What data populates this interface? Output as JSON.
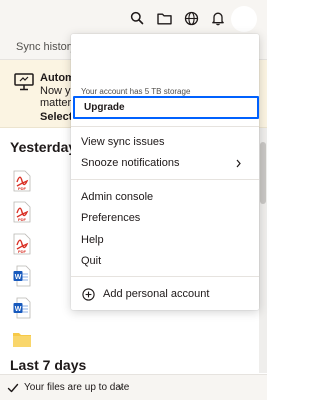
{
  "header": {
    "search_icon": "search-icon",
    "folder_icon": "folder-icon",
    "globe_icon": "globe-icon",
    "bell_icon": "bell-icon"
  },
  "section": {
    "title": "Sync history"
  },
  "banner": {
    "line1": "Automa",
    "line2": "Now yo",
    "line3": "matter",
    "line4": "Select f"
  },
  "groups": {
    "yesterday": "Yesterday",
    "last7": "Last 7 days"
  },
  "files": [
    {
      "type": "pdf",
      "icon": "pdf-icon",
      "label": "PDF"
    },
    {
      "type": "pdf",
      "icon": "pdf-icon",
      "label": "PDF"
    },
    {
      "type": "pdf",
      "icon": "pdf-icon",
      "label": "PDF"
    },
    {
      "type": "word",
      "icon": "word-doc-icon",
      "label": "W"
    },
    {
      "type": "word",
      "icon": "word-doc-icon",
      "label": "W"
    },
    {
      "type": "folder",
      "icon": "folder-icon"
    }
  ],
  "menu": {
    "storage_text": "Your account has 5 TB storage",
    "upgrade_label": "Upgrade",
    "view_sync_issues": "View sync issues",
    "snooze_notifications": "Snooze notifications",
    "admin_console": "Admin console",
    "preferences": "Preferences",
    "help": "Help",
    "quit": "Quit",
    "add_personal_account": "Add personal account"
  },
  "status": {
    "text": "Your files are up to date"
  },
  "colors": {
    "accent": "#0061fe",
    "pdf_red": "#d93025",
    "word_blue": "#185abd",
    "folder_yellow": "#f7c948"
  }
}
